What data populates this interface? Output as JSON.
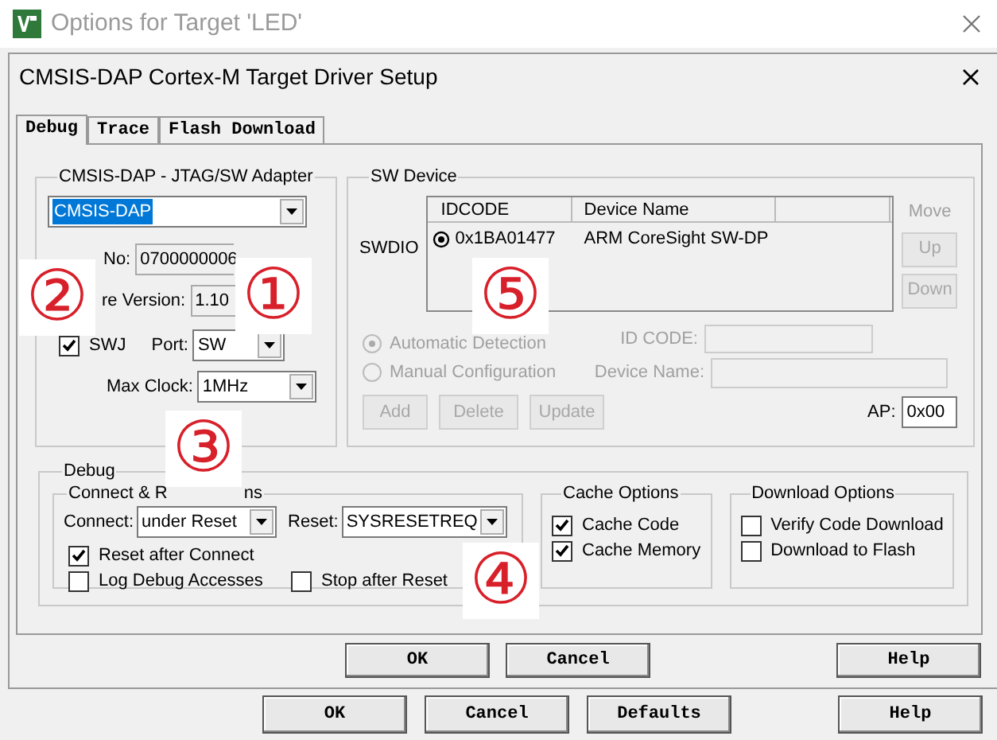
{
  "window": {
    "title": "Options for Target 'LED'"
  },
  "dialog": {
    "title": "CMSIS-DAP Cortex-M Target Driver Setup"
  },
  "tabs": [
    {
      "label": "Debug",
      "selected": true
    },
    {
      "label": "Trace",
      "selected": false
    },
    {
      "label": "Flash Download",
      "selected": false
    }
  ],
  "adapter": {
    "title": "CMSIS-DAP - JTAG/SW Adapter",
    "device": "CMSIS-DAP",
    "serial_label": "No:",
    "serial": "0700000006",
    "firmware_label": "re Version:",
    "firmware": "1.10",
    "swj": {
      "label": "SWJ",
      "checked": true
    },
    "port_label": "Port:",
    "port": "SW",
    "clock_label": "Max Clock:",
    "clock": "1MHz"
  },
  "sw_device": {
    "title": "SW Device",
    "disabled": true,
    "row_label": "SWDIO",
    "columns": [
      "IDCODE",
      "Device Name"
    ],
    "rows": [
      {
        "idcode": "0x1BA01477",
        "name": "ARM CoreSight SW-DP",
        "selected": true
      }
    ],
    "move_label": "Move",
    "move_buttons": [
      "Up",
      "Down"
    ],
    "modes": [
      {
        "label": "Automatic Detection",
        "selected": true
      },
      {
        "label": "Manual Configuration",
        "selected": false
      }
    ],
    "id_code_label": "ID CODE:",
    "device_name_label": "Device Name:",
    "buttons": [
      "Add",
      "Delete",
      "Update"
    ],
    "ap_label": "AP:",
    "ap": "0x00"
  },
  "debug": {
    "title": "Debug",
    "connect_reset": {
      "title_start": "Connect & R",
      "title_end": "ns",
      "connect_label": "Connect:",
      "connect": "under Reset",
      "reset_label": "Reset:",
      "reset": "SYSRESETREQ",
      "options": [
        {
          "label": "Reset after Connect",
          "checked": true
        },
        {
          "label": "Log Debug Accesses",
          "checked": false
        },
        {
          "label": "Stop after Reset",
          "checked": false
        }
      ]
    },
    "cache": {
      "title": "Cache Options",
      "options": [
        {
          "label": "Cache Code",
          "checked": true
        },
        {
          "label": "Cache Memory",
          "checked": true
        }
      ]
    },
    "download": {
      "title": "Download Options",
      "options": [
        {
          "label": "Verify Code Download",
          "checked": false
        },
        {
          "label": "Download to Flash",
          "checked": false
        }
      ]
    }
  },
  "dialog_buttons": [
    "OK",
    "Cancel",
    "Help"
  ],
  "window_buttons": [
    "OK",
    "Cancel",
    "Defaults",
    "Help"
  ],
  "annotations": [
    "②",
    "①",
    "⑤",
    "③",
    "④"
  ]
}
